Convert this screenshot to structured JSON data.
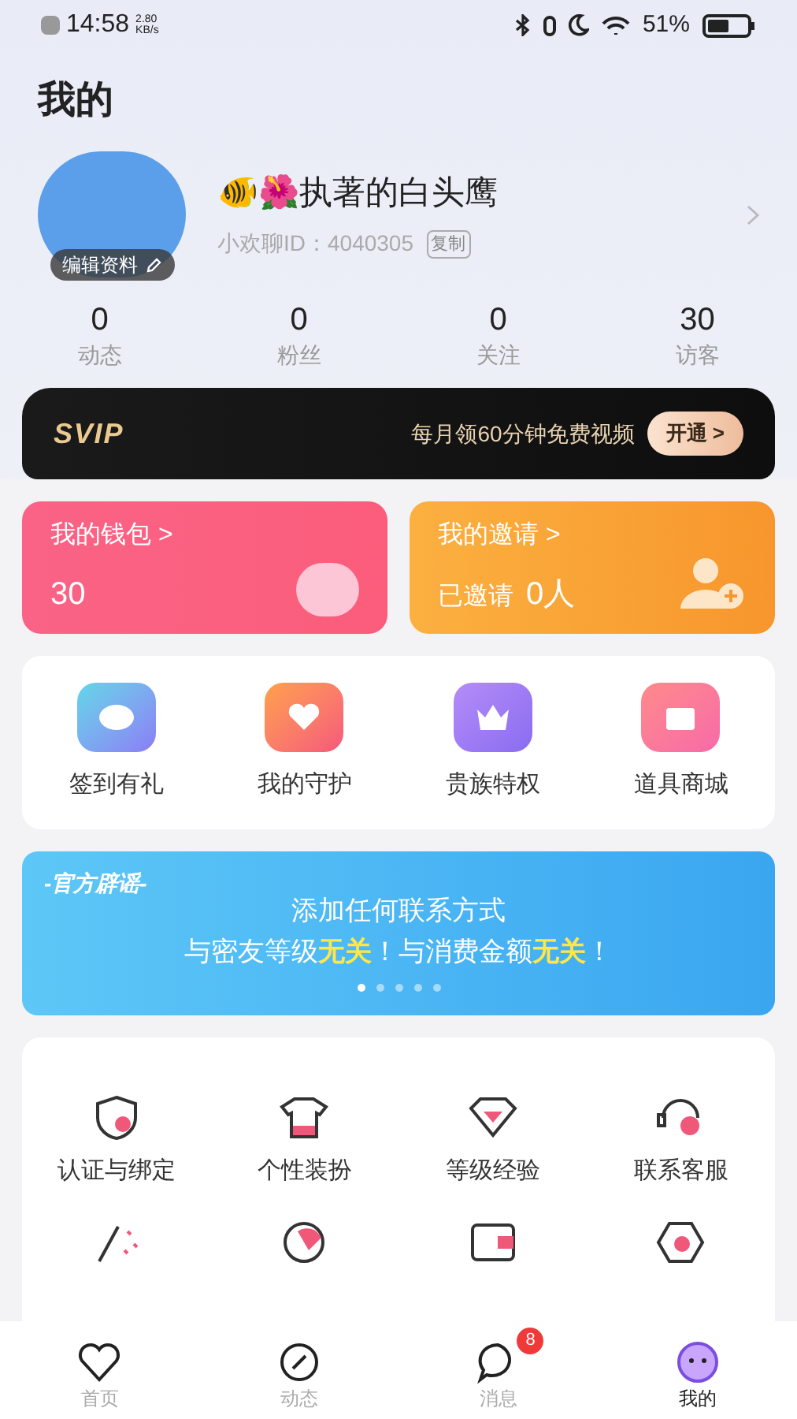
{
  "status_bar": {
    "time": "14:58",
    "speed_value": "2.80",
    "speed_unit": "KB/s",
    "battery": "51%"
  },
  "header": {
    "title": "我的"
  },
  "profile": {
    "edit_label": "编辑资料",
    "name": "🐠🌺执著的白头鹰",
    "id_text": "小欢聊ID：4040305",
    "copy_label": "复制"
  },
  "stats": [
    {
      "value": "0",
      "label": "动态"
    },
    {
      "value": "0",
      "label": "粉丝"
    },
    {
      "value": "0",
      "label": "关注"
    },
    {
      "value": "30",
      "label": "访客"
    }
  ],
  "svip": {
    "logo": "SVIP",
    "text": "每月领60分钟免费视频",
    "button": "开通 >"
  },
  "cards": [
    {
      "kind": "wallet",
      "title": "我的钱包 >",
      "value": "30"
    },
    {
      "kind": "invite",
      "title": "我的邀请 >",
      "prefix": "已邀请",
      "value": "0人"
    }
  ],
  "features": [
    {
      "kind": "bean",
      "label": "签到有礼"
    },
    {
      "kind": "guard",
      "label": "我的守护"
    },
    {
      "kind": "crown",
      "label": "贵族特权"
    },
    {
      "kind": "shop",
      "label": "道具商城"
    }
  ],
  "banner": {
    "tag": "-官方辟谣-",
    "line1": "添加任何联系方式",
    "line2": "与密友等级**无关**！与消费金额**无关**！",
    "dots": [
      {
        "selected": true
      },
      {
        "selected": false
      },
      {
        "selected": false
      },
      {
        "selected": false
      },
      {
        "selected": false
      }
    ]
  },
  "services": [
    {
      "kind": "shield",
      "label": "认证与绑定"
    },
    {
      "kind": "shirt",
      "label": "个性装扮"
    },
    {
      "kind": "gem",
      "label": "等级经验"
    },
    {
      "kind": "headset",
      "label": "联系客服"
    },
    {
      "kind": "wand"
    },
    {
      "kind": "help"
    },
    {
      "kind": "wallet"
    },
    {
      "kind": "gear"
    }
  ],
  "tab_bar": [
    {
      "kind": "home",
      "label": "首页",
      "selected": false
    },
    {
      "kind": "feed",
      "label": "动态",
      "selected": false
    },
    {
      "kind": "chat",
      "label": "消息",
      "selected": false,
      "badge": "8"
    },
    {
      "kind": "me",
      "label": "我的",
      "selected": true
    }
  ]
}
